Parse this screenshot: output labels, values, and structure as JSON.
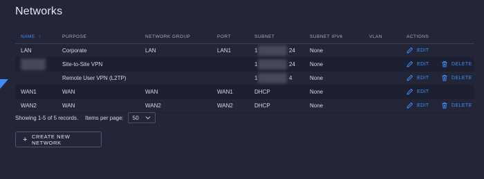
{
  "page": {
    "title": "Networks"
  },
  "table": {
    "columns": [
      "NAME",
      "PURPOSE",
      "NETWORK GROUP",
      "PORT",
      "SUBNET",
      "SUBNET IPV6",
      "VLAN",
      "ACTIONS"
    ],
    "sort_indicator": "↑",
    "rows": [
      {
        "name": "LAN",
        "purpose": "Corporate",
        "network_group": "LAN",
        "port": "LAN1",
        "subnet_start": "1",
        "subnet_end": "24",
        "subnet_ipv6": "None",
        "vlan": "",
        "edit": "EDIT",
        "delete": ""
      },
      {
        "name": "",
        "purpose": "Site-to-Site VPN",
        "network_group": "",
        "port": "",
        "subnet_start": "1",
        "subnet_end": "24",
        "subnet_ipv6": "None",
        "vlan": "",
        "edit": "EDIT",
        "delete": "DELETE"
      },
      {
        "name": "",
        "purpose": "Remote User VPN (L2TP)",
        "network_group": "",
        "port": "",
        "subnet_start": "1",
        "subnet_end": "4",
        "subnet_ipv6": "None",
        "vlan": "",
        "edit": "EDIT",
        "delete": "DELETE"
      },
      {
        "name": "WAN1",
        "purpose": "WAN",
        "network_group": "WAN",
        "port": "WAN1",
        "subnet_start": "DHCP",
        "subnet_end": "",
        "subnet_ipv6": "None",
        "vlan": "",
        "edit": "EDIT",
        "delete": ""
      },
      {
        "name": "WAN2",
        "purpose": "WAN",
        "network_group": "WAN2",
        "port": "WAN2",
        "subnet_start": "DHCP",
        "subnet_end": "",
        "subnet_ipv6": "None",
        "vlan": "",
        "edit": "EDIT",
        "delete": "DELETE"
      }
    ]
  },
  "pagination": {
    "summary": "Showing 1-5 of 5 records.",
    "per_page_label": "Items per page:",
    "per_page_value": "50"
  },
  "create_button": {
    "label": "CREATE NEW NETWORK"
  },
  "colors": {
    "accent": "#3e8ef7",
    "background": "#232638"
  },
  "icons": {
    "edit": "pencil-icon",
    "delete": "trash-icon",
    "create": "plus-icon",
    "select": "chevron-down-icon"
  }
}
